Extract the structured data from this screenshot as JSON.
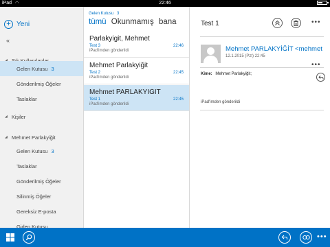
{
  "status_bar": {
    "device": "iPad",
    "time": "22:46",
    "battery_level": 0.55
  },
  "left_nav": {
    "new_label": "Yeni",
    "collapse_glyph": "«",
    "groups": [
      {
        "label": "Sık Kullanılanlar"
      },
      {
        "label": "Kişiler"
      },
      {
        "label": "Mehmet Parlakyiğit"
      }
    ],
    "favorites": [
      {
        "label": "Gelen Kutusu",
        "count": "3"
      },
      {
        "label": "Gönderilmiş Öğeler"
      },
      {
        "label": "Taslaklar"
      }
    ],
    "account_folders": [
      {
        "label": "Gelen Kutusu",
        "count": "3"
      },
      {
        "label": "Taslaklar"
      },
      {
        "label": "Gönderilmiş Öğeler"
      },
      {
        "label": "Silinmiş Öğeler"
      },
      {
        "label": "Gereksiz E-posta"
      },
      {
        "label": "Giden Kutusu"
      }
    ]
  },
  "message_list": {
    "folder_name": "Gelen Kutusu",
    "folder_count": "3",
    "filters": {
      "all": "tümü",
      "unread": "Okunmamış",
      "to_me": "bana"
    },
    "messages": [
      {
        "from": "Parlakyigit, Mehmet",
        "subject": "Test 3",
        "time": "22:46",
        "preview": "iPad'imden gönderildi"
      },
      {
        "from": "Mehmet Parlakyiğit",
        "subject": "Test 2",
        "time": "22:45",
        "preview": "iPad'imden gönderildi"
      },
      {
        "from": "Mehmet PARLAKYİĞİT",
        "subject": "Test 1",
        "time": "22:45",
        "preview": "iPad'imden gönderildi"
      }
    ]
  },
  "reading_pane": {
    "subject": "Test 1",
    "sender": "Mehmet PARLAKYİĞİT <mehmet",
    "date": "12.1.2015 (Pzt) 22:45",
    "to_label": "Kime:",
    "to_value": "Mehmet Parlakyiğit;",
    "body": "iPad'imden gönderildi"
  },
  "app_bar": {
    "accent": "#0072c6"
  },
  "colors": {
    "accent": "#0072c6",
    "selection": "#cde4f5",
    "nav_background": "#f1f1f1"
  }
}
